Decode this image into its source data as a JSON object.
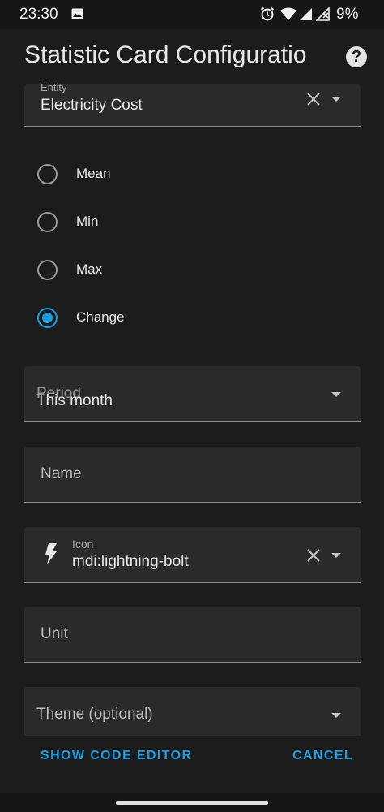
{
  "status_bar": {
    "time": "23:30",
    "battery": "9%"
  },
  "header": {
    "title": "Statistic Card Configuratio",
    "help_label": "?"
  },
  "entity_field": {
    "label": "Entity",
    "value": "Electricity Cost"
  },
  "stat_types": [
    {
      "label": "Mean",
      "checked": false
    },
    {
      "label": "Min",
      "checked": false
    },
    {
      "label": "Max",
      "checked": false
    },
    {
      "label": "Change",
      "checked": true
    }
  ],
  "period_field": {
    "label": "Period",
    "value": "This month"
  },
  "name_field": {
    "placeholder": "Name"
  },
  "icon_field": {
    "label": "Icon",
    "value": "mdi:lightning-bolt"
  },
  "unit_field": {
    "placeholder": "Unit"
  },
  "theme_field": {
    "placeholder": "Theme (optional)"
  },
  "footer": {
    "show_code_label": "SHOW CODE EDITOR",
    "cancel_label": "CANCEL"
  },
  "colors": {
    "accent": "#1f9ce0",
    "background": "#1c1c1c",
    "field": "#2a2a2a"
  }
}
